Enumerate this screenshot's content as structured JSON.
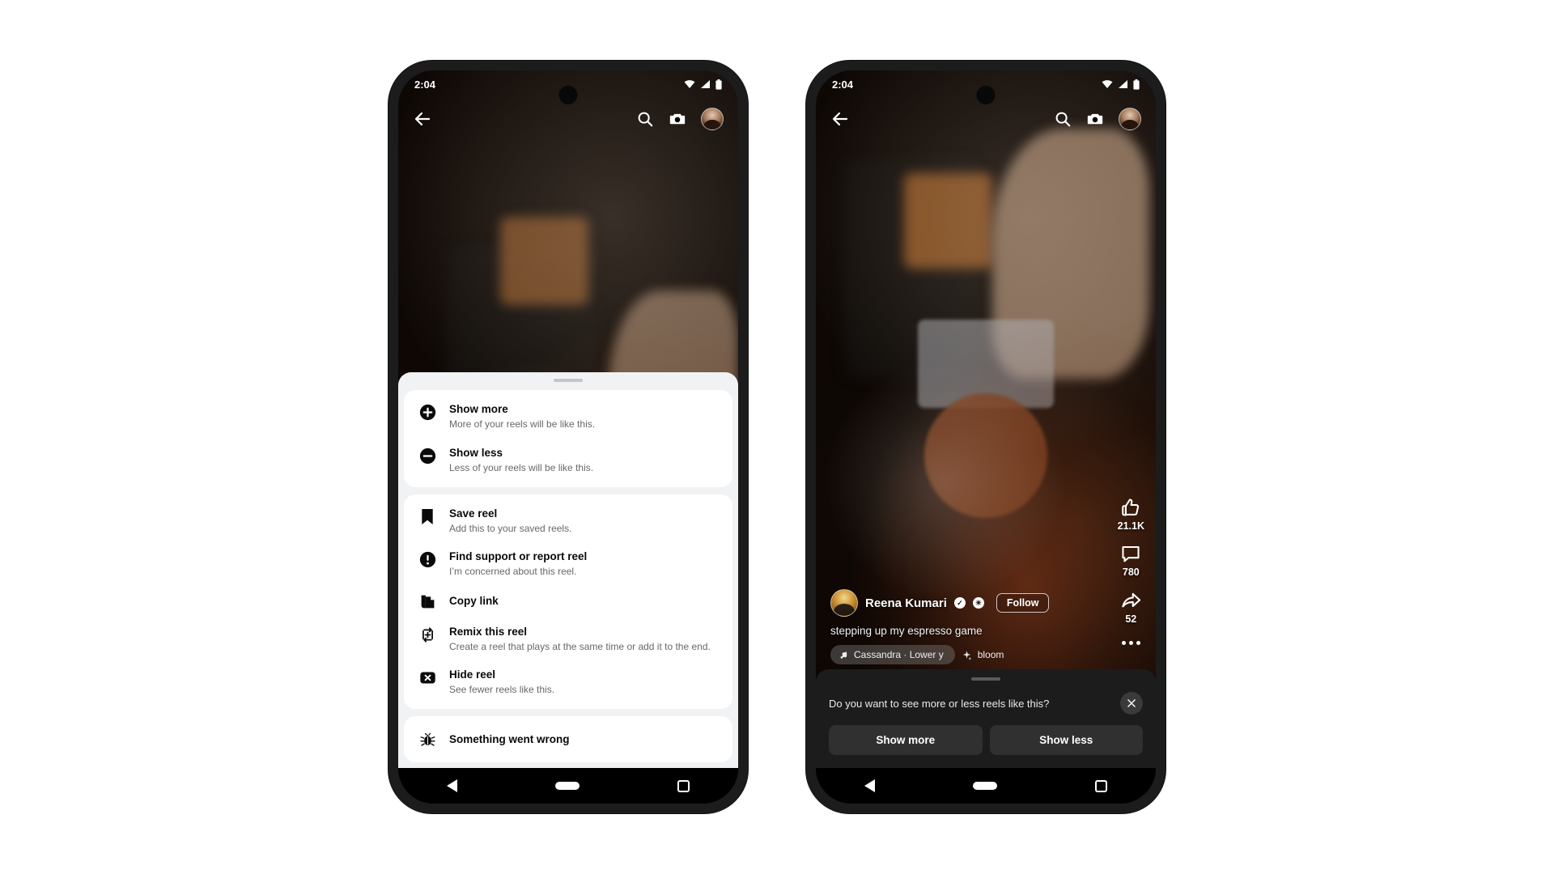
{
  "phone_left": {
    "status": {
      "time": "2:04",
      "icons": [
        "wifi-icon",
        "signal-icon",
        "battery-icon"
      ]
    },
    "topnav": {
      "back": "back-arrow-icon",
      "search": "search-icon",
      "camera": "camera-icon",
      "avatar": "profile-avatar"
    },
    "sheet": {
      "groups": [
        {
          "items": [
            {
              "icon": "plus-circle-icon",
              "title": "Show more",
              "sub": "More of your reels will be like this."
            },
            {
              "icon": "minus-circle-icon",
              "title": "Show less",
              "sub": "Less of your reels will be like this."
            }
          ]
        },
        {
          "items": [
            {
              "icon": "bookmark-icon",
              "title": "Save reel",
              "sub": "Add this to your saved reels."
            },
            {
              "icon": "exclamation-circle-icon",
              "title": "Find support or report reel",
              "sub": "I’m concerned about this reel."
            },
            {
              "icon": "copy-link-icon",
              "title": "Copy link",
              "sub": ""
            },
            {
              "icon": "remix-icon",
              "title": "Remix this reel",
              "sub": "Create a reel that plays at the same time or add it to the end."
            },
            {
              "icon": "hide-x-icon",
              "title": "Hide reel",
              "sub": "See fewer reels like this."
            }
          ]
        },
        {
          "items": [
            {
              "icon": "bug-icon",
              "title": "Something went wrong",
              "sub": ""
            }
          ]
        }
      ]
    },
    "navbar": {
      "back": "nav-back-icon",
      "home": "nav-home-icon",
      "recents": "nav-recents-icon"
    }
  },
  "phone_right": {
    "status": {
      "time": "2:04",
      "icons": [
        "wifi-icon",
        "signal-icon",
        "battery-icon"
      ]
    },
    "topnav": {
      "back": "back-arrow-icon",
      "search": "search-icon",
      "camera": "camera-icon",
      "avatar": "profile-avatar"
    },
    "reel": {
      "author": "Reena Kumari",
      "verified_badge": "verified-check-icon",
      "privacy_badge": "globe-icon",
      "follow_label": "Follow",
      "caption": "stepping up my espresso game",
      "music_chip": "Cassandra · Lower y",
      "effect_chip": "bloom",
      "music_icon": "music-note-icon",
      "effect_icon": "sparkle-icon"
    },
    "rail": {
      "like": {
        "icon": "thumbs-up-icon",
        "count": "21.1K"
      },
      "comment": {
        "icon": "comment-icon",
        "count": "780"
      },
      "share": {
        "icon": "share-arrow-icon",
        "count": "52"
      },
      "more": "more-dots-icon"
    },
    "prompt": {
      "question": "Do you want to see more or less reels like this?",
      "close": "close-icon",
      "show_more": "Show more",
      "show_less": "Show less"
    },
    "navbar": {
      "back": "nav-back-icon",
      "home": "nav-home-icon",
      "recents": "nav-recents-icon"
    }
  },
  "colors": {
    "sheet_bg": "#f1f2f4",
    "card_bg": "#ffffff",
    "title": "#0a0a0a",
    "subtitle": "#66686c",
    "dark_card": "#1c1c1c",
    "dark_button": "#303030"
  }
}
